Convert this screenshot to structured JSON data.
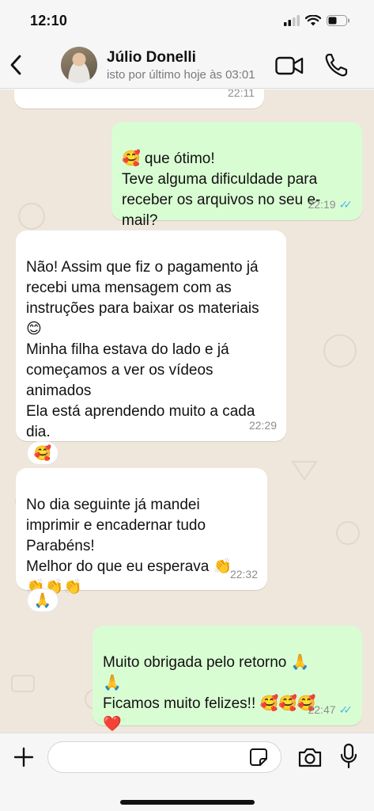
{
  "status_bar": {
    "time": "12:10"
  },
  "header": {
    "contact_name": "Júlio Donelli",
    "contact_status": "isto por último hoje às 03:01"
  },
  "messages": [
    {
      "direction": "in",
      "text": "",
      "time": "22:11"
    },
    {
      "direction": "out",
      "text": "🥰 que ótimo!\nTeve alguma dificuldade para receber os arquivos no seu e-mail?",
      "time": "22:19",
      "read": true
    },
    {
      "direction": "in",
      "text": "Não! Assim que fiz o pagamento já recebi uma mensagem com as instruções para baixar os materiais 😊\nMinha filha estava do lado e já começamos a ver os vídeos animados\nEla está aprendendo muito a cada dia.",
      "time": "22:29",
      "reaction": "🥰"
    },
    {
      "direction": "in",
      "text": "No dia seguinte já mandei imprimir e encadernar tudo\nParabéns!\nMelhor do que eu esperava 👏\n👏👏👏",
      "time": "22:32",
      "reaction": "🙏"
    },
    {
      "direction": "out",
      "text": "Muito obrigada pelo retorno 🙏\n🙏\nFicamos muito felizes!! 🥰🥰🥰\n❤️",
      "time": "22:47",
      "read": true
    }
  ],
  "composer": {
    "placeholder": ""
  },
  "colors": {
    "incoming": "#ffffff",
    "outgoing": "#d9fdd3",
    "read_ticks": "#4fb6ec",
    "chat_bg": "#efe7dc"
  }
}
